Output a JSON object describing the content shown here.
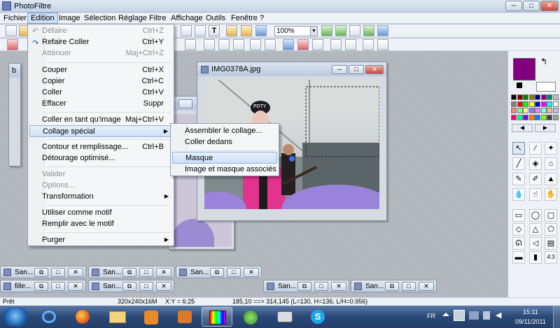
{
  "app": {
    "title": "PhotoFiltre"
  },
  "menubar": [
    "Fichier",
    "Edition",
    "Image",
    "Sélection",
    "Réglage",
    "Filtre",
    "Affichage",
    "Outils",
    "Fenêtre",
    "?"
  ],
  "toolbar": {
    "zoom": "100%"
  },
  "edition_menu": {
    "items": [
      {
        "label": "Défaire",
        "shortcut": "Ctrl+Z",
        "disabled": true
      },
      {
        "label": "Refaire Coller",
        "shortcut": "Ctrl+Y",
        "disabled": false
      },
      {
        "label": "Atténuer",
        "shortcut": "Maj+Ctrl+Z",
        "disabled": true
      },
      {
        "label": "Couper",
        "shortcut": "Ctrl+X",
        "disabled": false
      },
      {
        "label": "Copier",
        "shortcut": "Ctrl+C",
        "disabled": false
      },
      {
        "label": "Coller",
        "shortcut": "Ctrl+V",
        "disabled": false
      },
      {
        "label": "Effacer",
        "shortcut": "Suppr",
        "disabled": false
      },
      {
        "label": "Coller en tant qu'image",
        "shortcut": "Maj+Ctrl+V",
        "disabled": false
      },
      {
        "label": "Collage spécial",
        "shortcut": "",
        "disabled": false
      },
      {
        "label": "Contour et remplissage...",
        "shortcut": "Ctrl+B",
        "disabled": false
      },
      {
        "label": "Détourage optimisé...",
        "shortcut": "",
        "disabled": false
      },
      {
        "label": "Valider",
        "shortcut": "",
        "disabled": true
      },
      {
        "label": "Options...",
        "shortcut": "",
        "disabled": true
      },
      {
        "label": "Transformation",
        "shortcut": "",
        "disabled": false
      },
      {
        "label": "Utiliser comme motif",
        "shortcut": "",
        "disabled": false
      },
      {
        "label": "Remplir avec le motif",
        "shortcut": "",
        "disabled": false
      },
      {
        "label": "Purger",
        "shortcut": "",
        "disabled": false
      }
    ]
  },
  "collage_submenu": {
    "items": [
      "Assembler le collage...",
      "Coller dedans",
      "Masque",
      "Image et masque associés"
    ]
  },
  "image_window": {
    "title": "IMG0378A.jpg"
  },
  "photo_text": {
    "cap_text": "PDTY"
  },
  "minimized_windows": [
    "San...",
    "San...",
    "San...",
    "fille...",
    "San...",
    "San...",
    "San..."
  ],
  "background_windows": {
    "left_caption": "b"
  },
  "statusbar": {
    "status": "Prêt",
    "dimensions": "320x240x16M",
    "xy": "X:Y = 6:25",
    "selection": "185,10 ==> 314,145 (L=130, H=136, L/H=0.956)"
  },
  "taskbar": {
    "language": "FR",
    "time": "15:11",
    "date": "09/11/2011"
  },
  "palette": {
    "active_color": "#800080",
    "ratio_label": "4:3"
  },
  "title_buttons": {
    "minimize": "─",
    "maximize": "□",
    "close": "✕"
  }
}
